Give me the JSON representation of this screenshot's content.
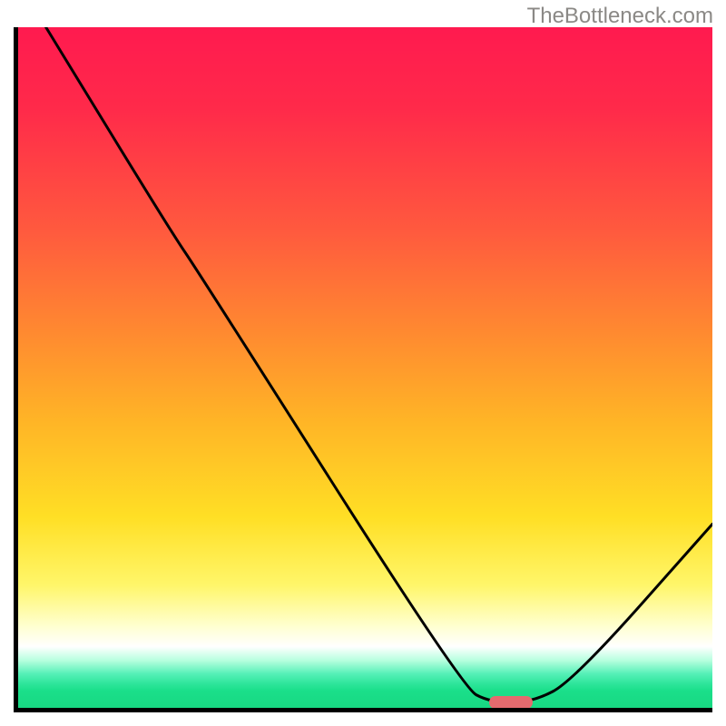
{
  "watermark": "TheBottleneck.com",
  "chart_data": {
    "type": "line",
    "title": "",
    "xlabel": "",
    "ylabel": "",
    "xlim": [
      0,
      100
    ],
    "ylim": [
      0,
      100
    ],
    "grid": false,
    "legend": false,
    "gradient_stops": [
      {
        "pct": 0,
        "color": "#ff1a4f"
      },
      {
        "pct": 12,
        "color": "#ff2a4a"
      },
      {
        "pct": 30,
        "color": "#ff5a3e"
      },
      {
        "pct": 45,
        "color": "#ff8a30"
      },
      {
        "pct": 58,
        "color": "#ffb526"
      },
      {
        "pct": 72,
        "color": "#ffdf25"
      },
      {
        "pct": 82,
        "color": "#fff66a"
      },
      {
        "pct": 88,
        "color": "#ffffd0"
      },
      {
        "pct": 91,
        "color": "#ffffff"
      },
      {
        "pct": 93,
        "color": "#b8ffdf"
      },
      {
        "pct": 95,
        "color": "#55f0b7"
      },
      {
        "pct": 96.5,
        "color": "#2de59a"
      },
      {
        "pct": 97.5,
        "color": "#1adf8a"
      },
      {
        "pct": 100,
        "color": "#18d882"
      }
    ],
    "curve_points_pct": [
      {
        "x": 4,
        "y": 100
      },
      {
        "x": 22,
        "y": 70
      },
      {
        "x": 26,
        "y": 64
      },
      {
        "x": 64,
        "y": 3
      },
      {
        "x": 68,
        "y": 0.8
      },
      {
        "x": 74,
        "y": 0.8
      },
      {
        "x": 80,
        "y": 4
      },
      {
        "x": 100,
        "y": 27
      }
    ],
    "bottleneck_marker_pct": {
      "x": 71,
      "y": 0.8
    },
    "marker_color": "#e46a6e"
  }
}
